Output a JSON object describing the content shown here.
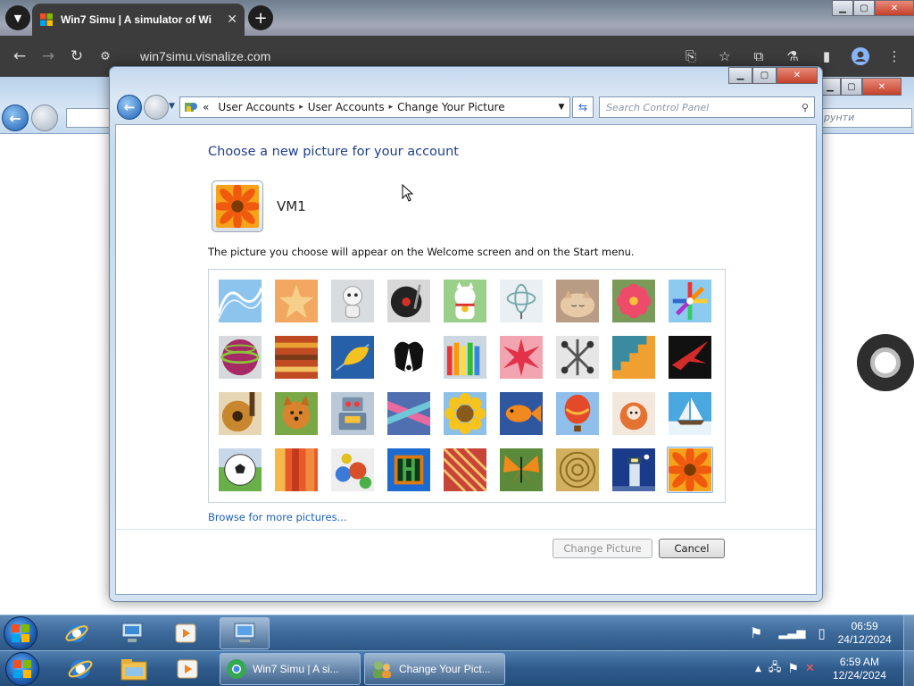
{
  "browser": {
    "tab_title": "Win7 Simu | A simulator of Wi",
    "url": "win7simu.visnalize.com",
    "tab_close": "✕",
    "new_tab": "+"
  },
  "dialog": {
    "breadcrumb": [
      "User Accounts",
      "User Accounts",
      "Change Your Picture"
    ],
    "breadcrumb_prefix": "«",
    "search_placeholder": "Search Control Panel",
    "heading": "Choose a new picture for your account",
    "account_name": "VM1",
    "description": "The picture you choose will appear on the Welcome screen and on the Start menu.",
    "browse_link": "Browse for more pictures...",
    "change_button": "Change Picture",
    "cancel_button": "Cancel",
    "selected_picture": "flower-orange",
    "pictures": [
      "roller-coaster",
      "starfish",
      "robot-white",
      "record-player",
      "lucky-cat",
      "gyroscope",
      "kitten",
      "flower-pink",
      "windmill",
      "ball-striped",
      "fabric",
      "leaf",
      "dog",
      "crayons",
      "paper-star",
      "jacks",
      "stairs",
      "origami-crane",
      "guitar",
      "puppy",
      "robot-toy",
      "scarf",
      "sunflower",
      "fish",
      "balloon",
      "doll",
      "sailboat",
      "soccer-ball",
      "fabric-orange",
      "marbles",
      "chess-board",
      "textile",
      "butterfly",
      "basket",
      "lighthouse",
      "flower-orange"
    ]
  },
  "background_window": {
    "search_text": "рунти"
  },
  "taskbar_inner": {
    "time": "06:59",
    "date": "24/12/2024"
  },
  "taskbar_outer": {
    "task1": "Win7 Simu | A si...",
    "task2": "Change Your Pict...",
    "time": "6:59 AM",
    "date": "12/24/2024"
  },
  "colors": {
    "heading": "#1e3f8a",
    "link": "#1c5fb8",
    "taskbar": "#3f6c9c"
  }
}
